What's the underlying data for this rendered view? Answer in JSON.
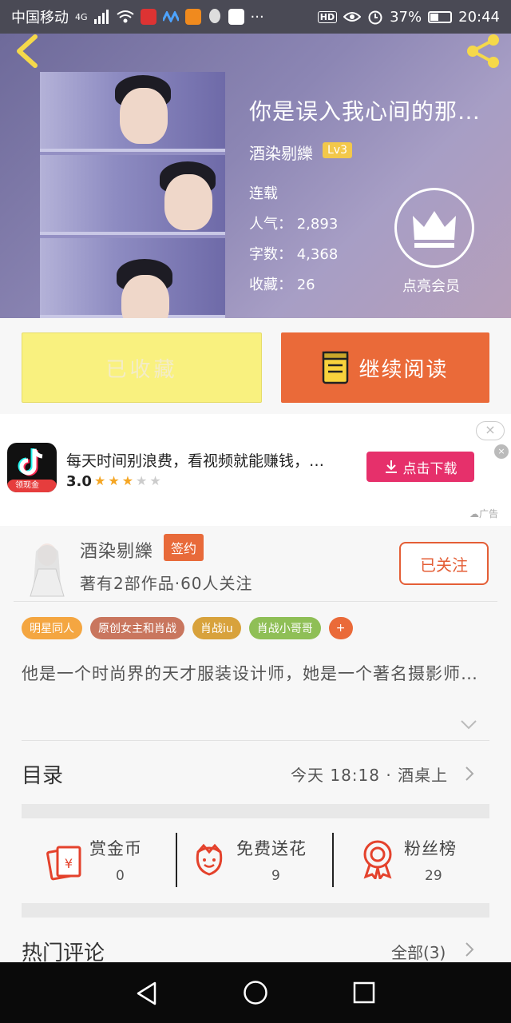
{
  "status_bar": {
    "carrier": "中国移动",
    "network": "4G",
    "hd": "HD",
    "battery": "37%",
    "battery_level": 0.37,
    "time": "20:44",
    "more": "···"
  },
  "book": {
    "title": "你是误入我心间的那…",
    "author": "酒染剔纅",
    "level": "Lv3",
    "status": "连载",
    "popularity_label": "人气：",
    "popularity": "2,893",
    "words_label": "字数：",
    "words": "4,368",
    "favorites_label": "收藏：",
    "favorites": "26",
    "vip_label": "点亮会员"
  },
  "actions": {
    "favorited": "已收藏",
    "continue_reading": "继续阅读"
  },
  "ad": {
    "icon_tag": "领现金",
    "text": "每天时间别浪费，看视频就能赚钱，…",
    "rating": "3.0",
    "rating_value": 3,
    "download": "点击下载",
    "close": "×",
    "label": "广告"
  },
  "author_card": {
    "name": "酒染剔纅",
    "signed": "签约",
    "works": "著有2部作品·60人关注",
    "follow": "已关注"
  },
  "tags": [
    {
      "label": "明星同人",
      "color": "#f4a641"
    },
    {
      "label": "原创女主和肖战",
      "color": "#c9765e"
    },
    {
      "label": "肖战iu",
      "color": "#d8a23c"
    },
    {
      "label": "肖战小哥哥",
      "color": "#8fbf56"
    },
    {
      "label": "+",
      "color": "#ea6a39"
    }
  ],
  "description": "他是一个时尚界的天才服装设计师，她是一个著名摄影师…",
  "catalog": {
    "label": "目录",
    "info": "今天 18:18 · 酒桌上"
  },
  "stats": [
    {
      "label": "赏金币",
      "value": "0"
    },
    {
      "label": "免费送花",
      "value": "9"
    },
    {
      "label": "粉丝榜",
      "value": "29"
    }
  ],
  "comments": {
    "label": "热门评论",
    "all": "全部(3)"
  },
  "colors": {
    "accent": "#ea6a39",
    "fav_button": "#f9f17f",
    "ad_download": "#e6306b"
  }
}
